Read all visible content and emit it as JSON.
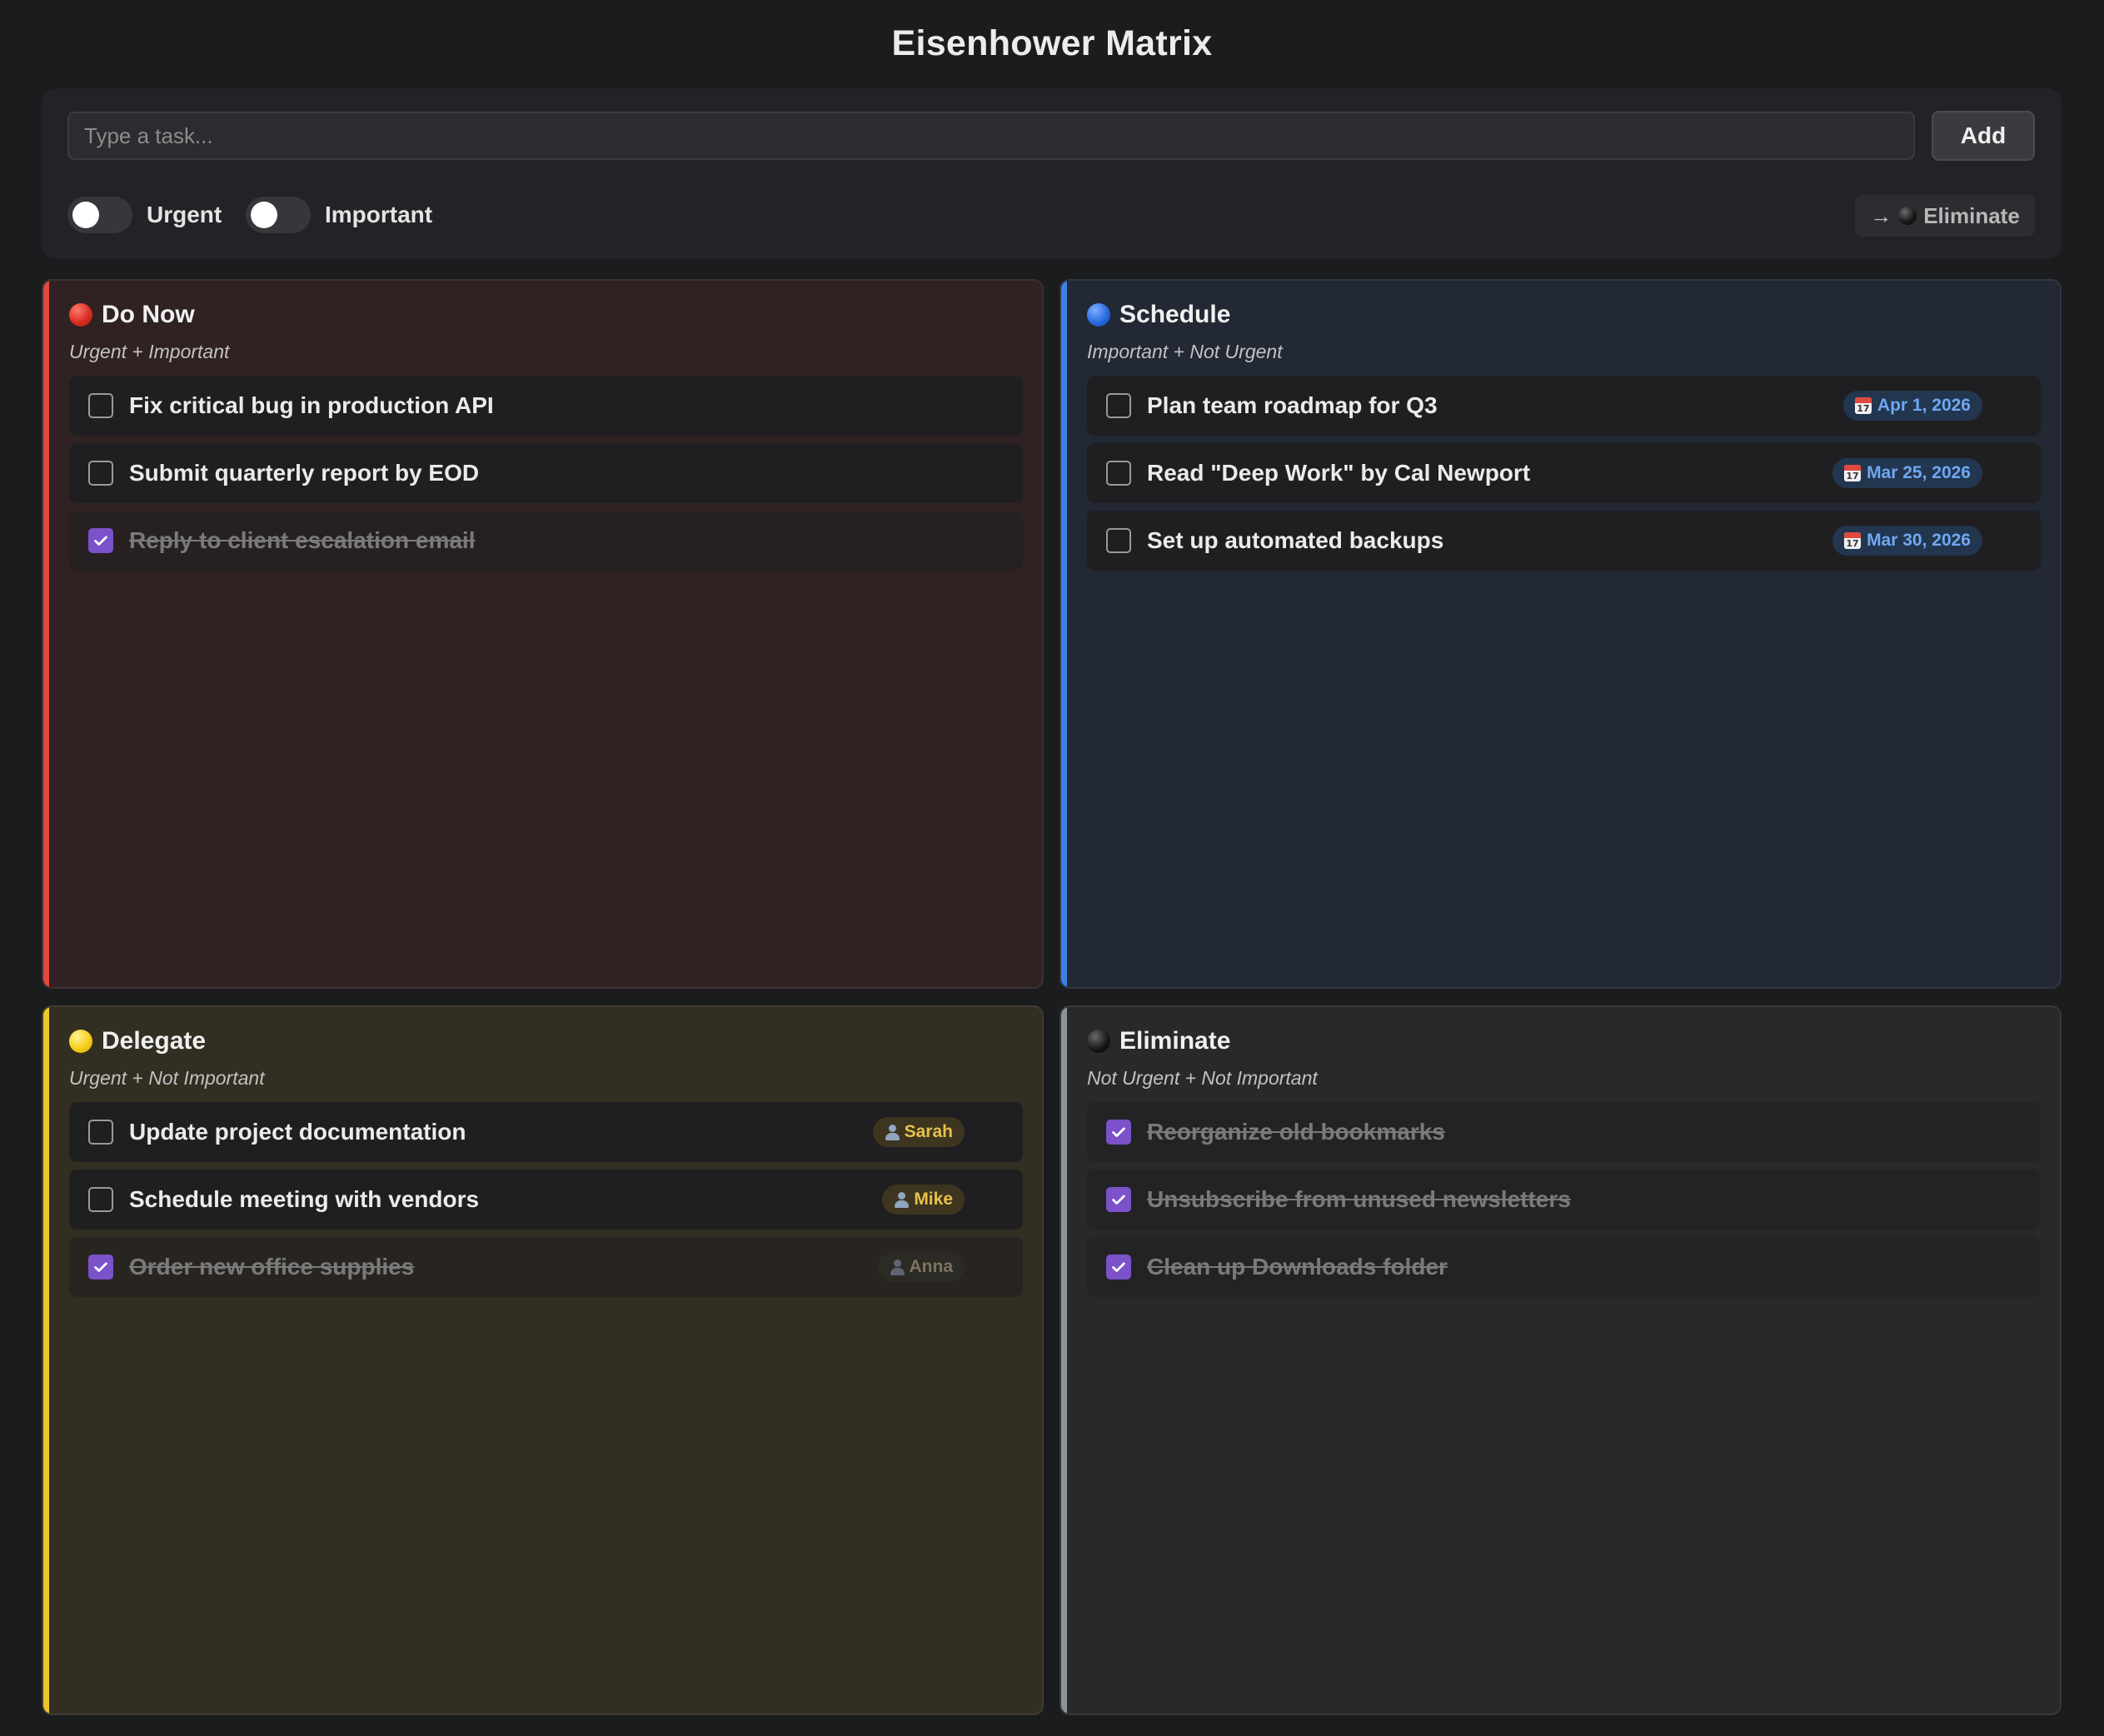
{
  "app": {
    "title": "Eisenhower Matrix"
  },
  "toolbar": {
    "input_placeholder": "Type a task...",
    "input_value": "",
    "add_label": "Add",
    "urgent_label": "Urgent",
    "important_label": "Important",
    "urgent_on": false,
    "important_on": false,
    "target_arrow": "→",
    "target_label": "Eliminate",
    "target_icon": "black-circle-icon"
  },
  "colors": {
    "do_now": "#e0493c",
    "schedule": "#3b82e6",
    "delegate": "#ecc62d",
    "eliminate": "#8e939a",
    "checkbox_checked": "#7b52c9"
  },
  "quadrants": {
    "do_now": {
      "icon": "red-circle-icon",
      "title": "Do Now",
      "subtitle": "Urgent + Important",
      "tasks": [
        {
          "text": "Fix critical bug in production API",
          "done": false
        },
        {
          "text": "Submit quarterly report by EOD",
          "done": false
        },
        {
          "text": "Reply to client escalation email",
          "done": true
        }
      ]
    },
    "schedule": {
      "icon": "blue-circle-icon",
      "title": "Schedule",
      "subtitle": "Important + Not Urgent",
      "tasks": [
        {
          "text": "Plan team roadmap for Q3",
          "done": false,
          "date": "Apr 1, 2026",
          "badge_icon": "calendar-icon"
        },
        {
          "text": "Read \"Deep Work\" by Cal Newport",
          "done": false,
          "date": "Mar 25, 2026",
          "badge_icon": "calendar-icon"
        },
        {
          "text": "Set up automated backups",
          "done": false,
          "date": "Mar 30, 2026",
          "badge_icon": "calendar-icon"
        }
      ]
    },
    "delegate": {
      "icon": "yellow-circle-icon",
      "title": "Delegate",
      "subtitle": "Urgent + Not Important",
      "tasks": [
        {
          "text": "Update project documentation",
          "done": false,
          "assignee": "Sarah",
          "badge_icon": "person-icon"
        },
        {
          "text": "Schedule meeting with vendors",
          "done": false,
          "assignee": "Mike",
          "badge_icon": "person-icon"
        },
        {
          "text": "Order new office supplies",
          "done": true,
          "assignee": "Anna",
          "badge_icon": "person-icon"
        }
      ]
    },
    "eliminate": {
      "icon": "black-circle-icon",
      "title": "Eliminate",
      "subtitle": "Not Urgent + Not Important",
      "tasks": [
        {
          "text": "Reorganize old bookmarks",
          "done": true
        },
        {
          "text": "Unsubscribe from unused newsletters",
          "done": true
        },
        {
          "text": "Clean up Downloads folder",
          "done": true
        }
      ]
    }
  }
}
